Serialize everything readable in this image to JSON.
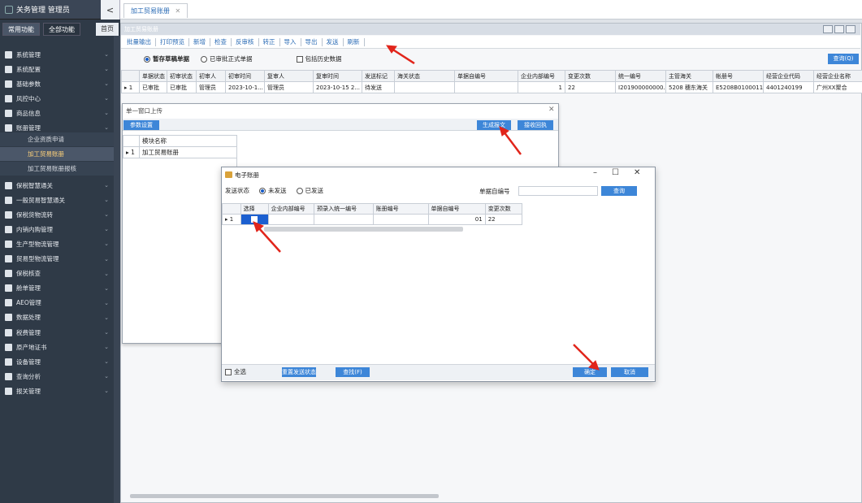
{
  "app": {
    "title": "关务管理 管理员"
  },
  "sidebar": {
    "tabs": [
      {
        "label": "常用功能"
      },
      {
        "label": "全部功能"
      }
    ],
    "home_tab": "首页",
    "items": [
      {
        "label": "系统管理"
      },
      {
        "label": "系统配置"
      },
      {
        "label": "基础参数"
      },
      {
        "label": "风控中心"
      },
      {
        "label": "商品信息"
      },
      {
        "label": "账册管理"
      },
      {
        "label": "保税智慧通关"
      },
      {
        "label": "一般贸易智慧通关"
      },
      {
        "label": "保税货物流转"
      },
      {
        "label": "内销内购管理"
      },
      {
        "label": "生产型物流管理"
      },
      {
        "label": "贸易型物流管理"
      },
      {
        "label": "保税核查"
      },
      {
        "label": "舱单管理"
      },
      {
        "label": "AEO管理"
      },
      {
        "label": "数据处理"
      },
      {
        "label": "税费管理"
      },
      {
        "label": "原产地证书"
      },
      {
        "label": "设备管理"
      },
      {
        "label": "查询分析"
      },
      {
        "label": "报关管理"
      }
    ],
    "sub_items": [
      {
        "label": "企业资质申请"
      },
      {
        "label": "加工贸易账册"
      },
      {
        "label": "加工贸易账册报核"
      }
    ]
  },
  "main": {
    "tab_label": "加工贸易账册",
    "panel_title": "加工贸易账册",
    "toolbar": [
      {
        "label": "批量输出"
      },
      {
        "label": "打印预览"
      },
      {
        "label": "新增"
      },
      {
        "label": "检查"
      },
      {
        "label": "反审核"
      },
      {
        "label": "转正"
      },
      {
        "label": "导入"
      },
      {
        "label": "导出"
      },
      {
        "label": "发送"
      },
      {
        "label": "刷新"
      }
    ],
    "filter": {
      "radio1": "暂存草稿单据",
      "radio2": "已审批正式单据",
      "checkbox": "包括历史数据",
      "query_button": "查询(Q)"
    },
    "grid": {
      "headers": [
        "",
        "单据状态",
        "初审状态",
        "初审人",
        "初审时间",
        "复审人",
        "复审时间",
        "发送标记",
        "海关状态",
        "单据自编号",
        "企业内部编号",
        "变更次数",
        "统一编号",
        "主管海关",
        "帐册号",
        "经营企业代码",
        "经营企业名称"
      ],
      "rows": [
        [
          "▸ 1",
          "已审批",
          "已审批",
          "管理员",
          "2023-10-1...",
          "管理员",
          "2023-10-15 2...",
          "待发送",
          "",
          "",
          "1",
          "22",
          "I201900000000...",
          "5208 穗东海关",
          "E5208B0100011",
          "4401240199",
          "广州XX聚合"
        ]
      ]
    }
  },
  "upload_dialog": {
    "title": "单一窗口上传",
    "param_button": "参数设置",
    "generate_button": "生成报文",
    "receipt_button": "接收回执",
    "module_header": "模块名称",
    "module_row_num": "▸ 1",
    "module_row": "加工贸易账册"
  },
  "ebook_dialog": {
    "title": "电子账册",
    "send_status_label": "发送状态",
    "radio_unsent": "未发送",
    "radio_sent": "已发送",
    "docno_label": "单据自编号",
    "query_button": "查询",
    "headers": [
      "",
      "选择",
      "企业内部编号",
      "预录入统一编号",
      "账册编号",
      "单据自编号",
      "变更次数"
    ],
    "rows": [
      [
        "▸ 1",
        "",
        "",
        "",
        "",
        "01",
        "22"
      ]
    ],
    "select_all": "全选",
    "reset_button": "重置发送状态",
    "find_button": "查找(F)",
    "ok_button": "确定",
    "cancel_button": "取消"
  }
}
